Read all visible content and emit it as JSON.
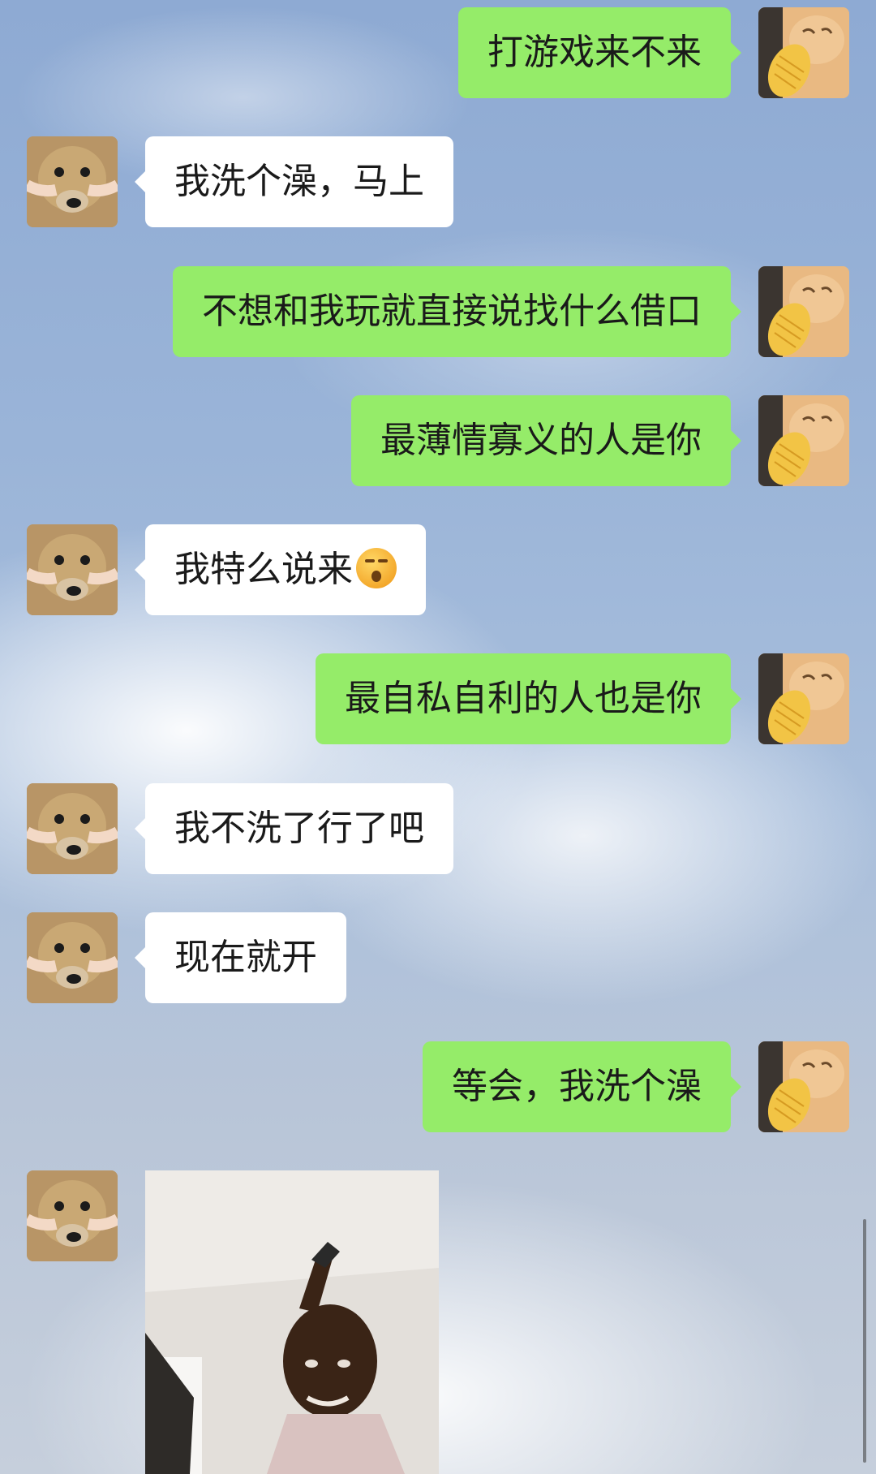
{
  "messages": [
    {
      "side": "out",
      "text": "打游戏来不来"
    },
    {
      "side": "in",
      "text": "我洗个澡，马上"
    },
    {
      "side": "out",
      "text": "不想和我玩就直接说找什么借口"
    },
    {
      "side": "out",
      "text": "最薄情寡义的人是你"
    },
    {
      "side": "in",
      "text": "我特么说来"
    },
    {
      "side": "out",
      "text": "最自私自利的人也是你"
    },
    {
      "side": "in",
      "text": "我不洗了行了吧"
    },
    {
      "side": "in",
      "text": "现在就开"
    },
    {
      "side": "out",
      "text": "等会，我洗个澡"
    }
  ],
  "emoji_icon": "sleepy-face-emoji",
  "colors": {
    "outgoing_bubble": "#95ec69",
    "incoming_bubble": "#ffffff"
  }
}
